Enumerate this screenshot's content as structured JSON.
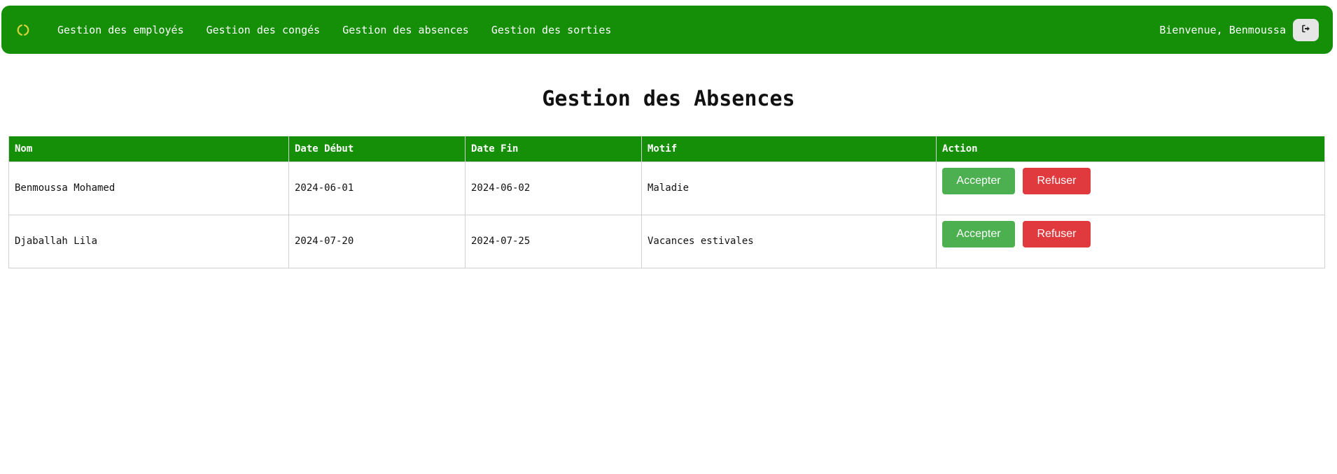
{
  "navbar": {
    "logo_icon": "spinner-icon",
    "links": [
      {
        "label": "Gestion des employés"
      },
      {
        "label": "Gestion des congés"
      },
      {
        "label": "Gestion des absences"
      },
      {
        "label": "Gestion des sorties"
      }
    ],
    "welcome_text": "Bienvenue, Benmoussa",
    "logout_icon": "sign-out-icon"
  },
  "page": {
    "title": "Gestion des Absences"
  },
  "table": {
    "headers": [
      "Nom",
      "Date Début",
      "Date Fin",
      "Motif",
      "Action"
    ],
    "rows": [
      {
        "nom": "Benmoussa Mohamed",
        "date_debut": "2024-06-01",
        "date_fin": "2024-06-02",
        "motif": "Maladie",
        "accept_label": "Accepter",
        "refuse_label": "Refuser"
      },
      {
        "nom": "Djaballah Lila",
        "date_debut": "2024-07-20",
        "date_fin": "2024-07-25",
        "motif": "Vacances estivales",
        "accept_label": "Accepter",
        "refuse_label": "Refuser"
      }
    ]
  },
  "colors": {
    "brand_green": "#148f07",
    "accept_green": "#4caf50",
    "refuse_red": "#e03a3e",
    "logout_bg": "#e6e6e6"
  }
}
